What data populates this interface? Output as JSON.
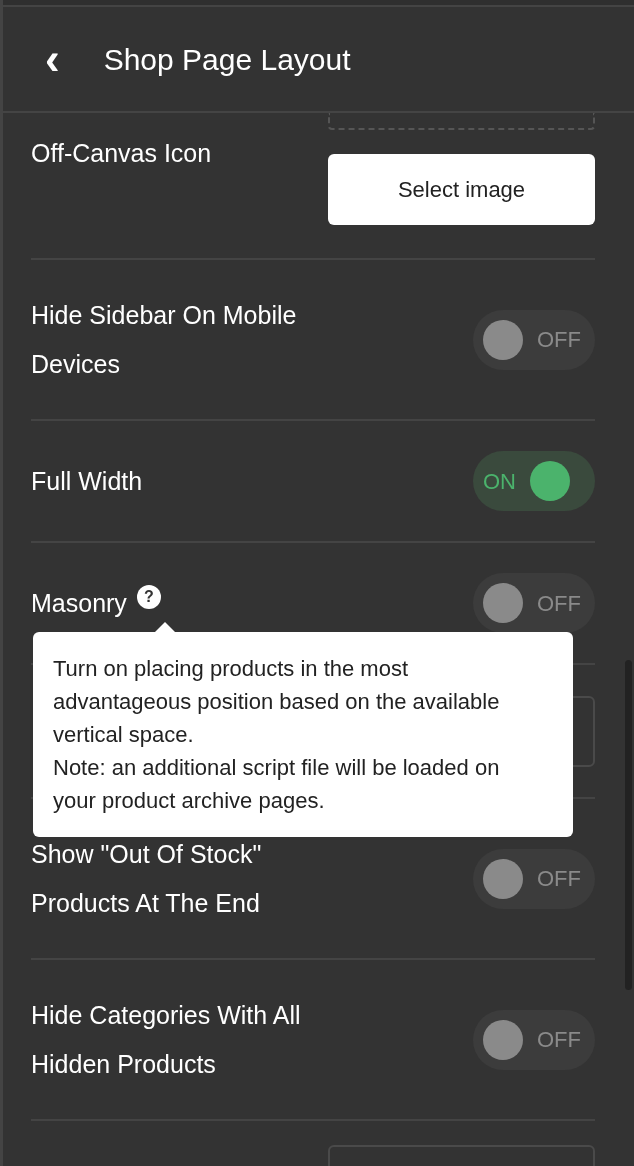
{
  "header": {
    "back": "‹",
    "title": "Shop Page Layout"
  },
  "rows": [
    {
      "kind": "image",
      "label": "Off-Canvas Icon",
      "button": "Select image"
    },
    {
      "kind": "toggle",
      "label": "Hide Sidebar On Mobile Devices",
      "on": false,
      "state_text": "OFF"
    },
    {
      "kind": "toggle",
      "label": "Full Width",
      "on": true,
      "state_text": "ON"
    },
    {
      "kind": "toggle",
      "label": "Masonry",
      "on": false,
      "state_text": "OFF",
      "help": "?",
      "tooltip": [
        "Turn on placing products in the most advantageous position based on the available vertical space.",
        "Note: an additional script file will be loaded on your product archive pages."
      ]
    },
    {
      "kind": "select"
    },
    {
      "kind": "toggle",
      "label": "Show \"Out Of Stock\" Products At The End",
      "on": false,
      "state_text": "OFF"
    },
    {
      "kind": "toggle",
      "label": "Hide Categories With All Hidden Products",
      "on": false,
      "state_text": "OFF"
    },
    {
      "kind": "partial"
    }
  ]
}
